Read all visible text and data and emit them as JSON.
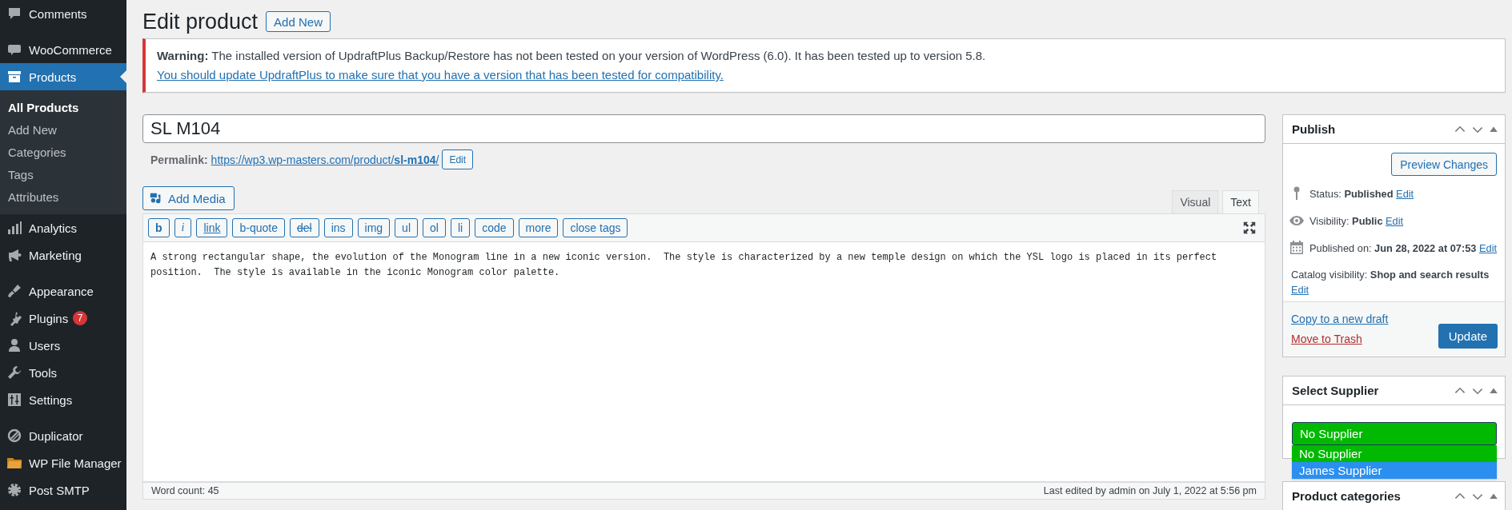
{
  "sidebar": {
    "groups": [
      {
        "items": [
          {
            "label": "Comments",
            "selected": false
          }
        ]
      },
      {
        "items": [
          {
            "label": "WooCommerce",
            "selected": false
          },
          {
            "label": "Products",
            "selected": true,
            "children": [
              {
                "label": "All Products",
                "selected": true
              },
              {
                "label": "Add New",
                "selected": false
              },
              {
                "label": "Categories",
                "selected": false
              },
              {
                "label": "Tags",
                "selected": false
              },
              {
                "label": "Attributes",
                "selected": false
              }
            ]
          },
          {
            "label": "Analytics",
            "selected": false
          },
          {
            "label": "Marketing",
            "selected": false
          }
        ]
      },
      {
        "items": [
          {
            "label": "Appearance",
            "selected": false
          },
          {
            "label": "Plugins",
            "selected": false,
            "badge": "7"
          },
          {
            "label": "Users",
            "selected": false
          },
          {
            "label": "Tools",
            "selected": false
          },
          {
            "label": "Settings",
            "selected": false
          }
        ]
      },
      {
        "items": [
          {
            "label": "Duplicator",
            "selected": false
          },
          {
            "label": "WP File Manager",
            "selected": false
          },
          {
            "label": "Post SMTP",
            "selected": false
          }
        ]
      }
    ]
  },
  "header": {
    "title": "Edit product",
    "button": "Add New"
  },
  "notice": {
    "text": "**Warning:** The installed version of UpdraftPlus Backup/Restore has not been tested on your version of WordPress (6.0). It has been tested up to version 5.8.",
    "link": "You should update UpdraftPlus to make sure that you have a version that has been tested for compatibility."
  },
  "product": {
    "title": "SL M104",
    "permalink": {
      "label": "Permalink:",
      "url": "https://wp3.wp-masters.com/product/**sl-m104**/",
      "button": "Edit"
    }
  },
  "editor": {
    "add_media": "Add Media",
    "tabs": [
      {
        "label": "Visual",
        "selected": false
      },
      {
        "label": "Text",
        "selected": true
      }
    ],
    "toolbar": [
      {
        "label": "b",
        "kind": "bold"
      },
      {
        "label": "i",
        "kind": "italic"
      },
      {
        "label": "link",
        "kind": "underline"
      },
      {
        "label": "b-quote",
        "kind": "plain"
      },
      {
        "label": "del",
        "kind": "strike"
      },
      {
        "label": "ins",
        "kind": "plain"
      },
      {
        "label": "img",
        "kind": "plain"
      },
      {
        "label": "ul",
        "kind": "plain"
      },
      {
        "label": "ol",
        "kind": "plain"
      },
      {
        "label": "li",
        "kind": "plain"
      },
      {
        "label": "code",
        "kind": "plain"
      },
      {
        "label": "more",
        "kind": "plain"
      },
      {
        "label": "close tags",
        "kind": "plain"
      }
    ],
    "content": "A strong rectangular shape, the evolution of the Monogram line in a new iconic version.  The style is characterized by a new temple design on which the YSL logo is placed in its perfect position.  The style is available in the iconic Monogram color palette.",
    "word_count": "Word count: 45",
    "last_edited": "Last edited by admin on July 1, 2022 at 5:56 pm"
  },
  "publish": {
    "title": "Publish",
    "preview_button": "Preview Changes",
    "rows": [
      {
        "text": "Status: **Published**",
        "link": "Edit"
      },
      {
        "text": "Visibility: **Public**",
        "link": "Edit"
      },
      {
        "text": "Published on: **Jun 28, 2022 at 07:53**",
        "link": "Edit"
      }
    ],
    "catalog": {
      "text": "Catalog visibility: **Shop and search results**",
      "link": "Edit"
    },
    "copy_link": "Copy to a new draft",
    "trash_link": "Move to Trash",
    "update_button": "Update"
  },
  "supplier": {
    "title": "Select Supplier",
    "value": "No Supplier",
    "options": [
      {
        "label": "No Supplier",
        "highlighted": false
      },
      {
        "label": "James Supplier",
        "highlighted": true
      }
    ]
  },
  "categories": {
    "title": "Product categories"
  }
}
